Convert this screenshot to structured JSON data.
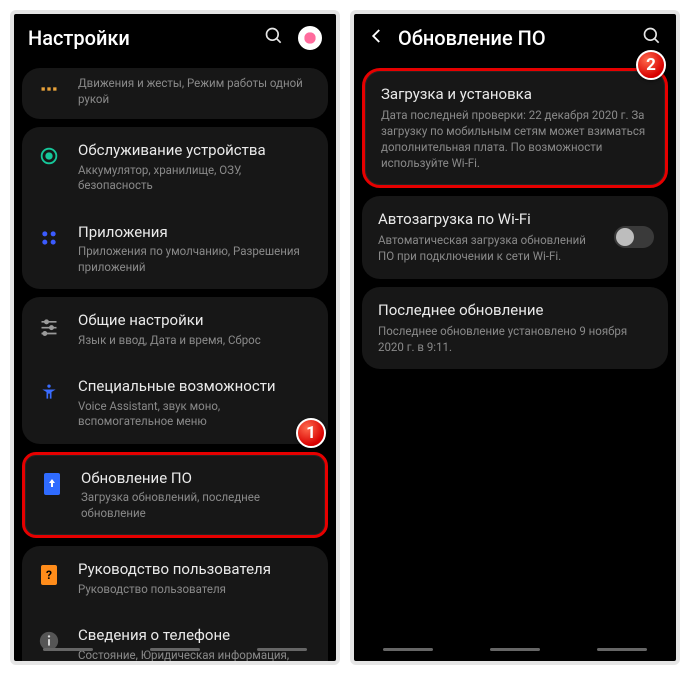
{
  "left": {
    "header_title": "Настройки",
    "items": {
      "motion_sub": "Движения и жесты, Режим работы одной рукой",
      "care_title": "Обслуживание устройства",
      "care_sub": "Аккумулятор, хранилище, ОЗУ, безопасность",
      "apps_title": "Приложения",
      "apps_sub": "Приложения по умолчанию, Разрешения приложений",
      "general_title": "Общие настройки",
      "general_sub": "Язык и ввод, Дата и время, Сброс",
      "access_title": "Специальные возможности",
      "access_sub": "Voice Assistant, звук моно, вспомогательное меню",
      "update_title": "Обновление ПО",
      "update_sub": "Загрузка обновлений, последнее обновление",
      "manual_title": "Руководство пользователя",
      "manual_sub": "Руководство пользователя",
      "about_title": "Сведения о телефоне",
      "about_sub": "Состояние, Юридическая информация,"
    }
  },
  "right": {
    "header_title": "Обновление ПО",
    "download_title": "Загрузка и установка",
    "download_sub": "Дата последней проверки: 22 декабря 2020 г. За загрузку по мобильным сетям может взиматься дополнительная плата. По возможности используйте Wi-Fi.",
    "auto_title": "Автозагрузка по Wi-Fi",
    "auto_sub": "Автоматическая загрузка обновлений ПО при подключении к сети Wi-Fi.",
    "last_title": "Последнее обновление",
    "last_sub": "Последнее обновление установлено 9 ноября 2020 г. в 9:11."
  },
  "badges": {
    "one": "1",
    "two": "2"
  }
}
